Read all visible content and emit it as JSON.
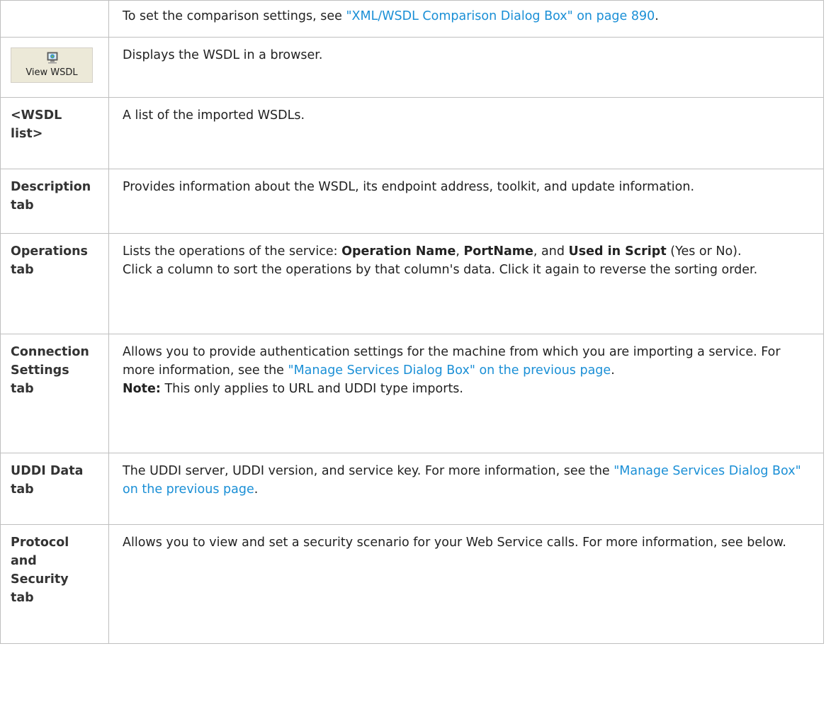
{
  "rows": [
    {
      "label": "",
      "text_before": "To set the comparison settings, see ",
      "link": "\"XML/WSDL Comparison Dialog Box\" on page 890",
      "text_after": "."
    },
    {
      "icon": {
        "name": "view-wsdl-icon",
        "caption": "View WSDL"
      },
      "text": "Displays the WSDL in a browser."
    },
    {
      "label_line1": "<WSDL",
      "label_line2": "list>",
      "text": "A list of the imported WSDLs."
    },
    {
      "label_line1": "Description",
      "label_line2": "tab",
      "text": "Provides information about the WSDL, its endpoint address, toolkit, and update information."
    },
    {
      "label_line1": "Operations",
      "label_line2": "tab",
      "p1_before": "Lists the operations of the service: ",
      "b1": "Operation Name",
      "sep1": ", ",
      "b2": "PortName",
      "sep2": ", and ",
      "b3": "Used in Script",
      "p1_after": " (Yes or No).",
      "p2": "Click a column to sort the operations by that column's data. Click it again to reverse the sorting order."
    },
    {
      "label_line1": "Connection",
      "label_line2": "Settings",
      "label_line3": "tab",
      "p1_before": "Allows you to provide authentication settings for the machine from which you are importing a service. For more information, see the ",
      "link": "\"Manage Services Dialog Box\" on the previous page",
      "p1_after": ".",
      "note_label": "Note:",
      "note_text": " This only applies to URL and UDDI type imports."
    },
    {
      "label_line1": "UDDI Data",
      "label_line2": "tab",
      "text_before": "The UDDI server, UDDI version, and service key. For more information, see the ",
      "link": "\"Manage Services Dialog Box\" on the previous page",
      "text_after": "."
    },
    {
      "label_line1": "Protocol",
      "label_line2": "and",
      "label_line3": "Security",
      "label_line4": "tab",
      "text": "Allows you to view and set a security scenario for your Web Service calls. For more information, see below."
    }
  ]
}
